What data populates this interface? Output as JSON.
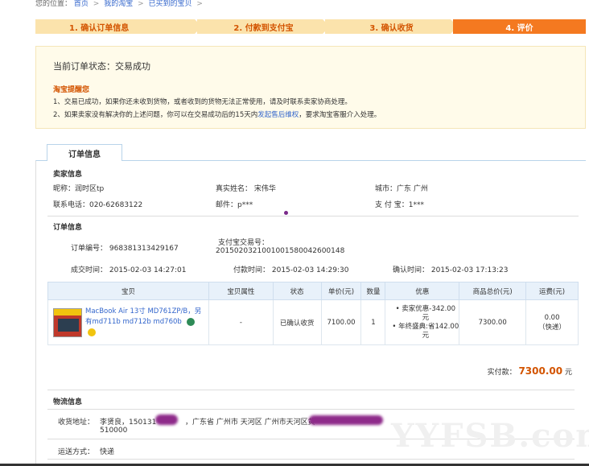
{
  "breadcrumb": {
    "prefix": "您的位置：",
    "items": [
      "首页",
      "我的淘宝",
      "已买到的宝贝"
    ],
    "sep": ">"
  },
  "steps": [
    {
      "label": "1. 确认订单信息"
    },
    {
      "label": "2. 付款到支付宝"
    },
    {
      "label": "3. 确认收货"
    },
    {
      "label": "4. 评价"
    }
  ],
  "status": {
    "text": "当前订单状态：交易成功",
    "tip_title": "淘宝提醒您",
    "tip1": "1、交易已成功，如果你还未收到货物，或者收到的货物无法正常使用，请及时联系卖家协商处理。",
    "tip2_pre": "2、如果卖家没有解决你的上述问题，你可以在交易成功后的15天内",
    "tip2_link": "发起售后维权",
    "tip2_post": "，要求淘宝客服介入处理。"
  },
  "tab": {
    "label": "订单信息"
  },
  "seller": {
    "title": "卖家信息",
    "nick": "昵称：润时区tp",
    "real_name": "真实姓名：  宋伟华",
    "city": "城市：广东 广州",
    "phone": "联系电话：020-62683122",
    "email": "邮件：p***",
    "alipay": "支 付 宝：1***"
  },
  "order": {
    "title": "订单信息",
    "order_no": "订单编号：   968381313429167",
    "alipay_no_label": "支付宝交易号：",
    "alipay_no": "2015020321001001580042600148",
    "created": "成交时间：   2015-02-03 14:27:01",
    "paid_time": "付款时间：   2015-02-03 14:29:30",
    "confirm_time": "确认时间：   2015-02-03 17:13:23"
  },
  "table": {
    "headers": [
      "宝贝",
      "宝贝属性",
      "状态",
      "单价(元)",
      "数量",
      "优惠",
      "商品总价(元)",
      "运费(元)"
    ],
    "row": {
      "name": "MacBook Air 13寸 MD761ZP/B，另有md711b md712b md760b",
      "attr": "-",
      "status": "已确认收货",
      "price": "7100.00",
      "qty": "1",
      "discount1": "• 卖家优惠-342.00元",
      "discount2": "• 年终盛典:省142.00元",
      "total": "7300.00",
      "shipping": "0.00",
      "shipping_type": "（快递）"
    }
  },
  "paid": {
    "label": "实付款：",
    "amount": "7300.00",
    "unit": "元"
  },
  "logistics": {
    "title": "物流信息",
    "addr_label": "收货地址：",
    "addr_name": "李贤良，150131",
    "addr_mid": "，广东省 广州市 天河区 广州市天河区黄",
    "zip": "510000",
    "method_label": "运送方式：",
    "method": "快递"
  },
  "watermark": "YYFSB.com",
  "colors": {
    "accent": "#f47920",
    "step_bg": "#fbe3ac",
    "link": "#3366cc",
    "amount": "#d35400"
  }
}
